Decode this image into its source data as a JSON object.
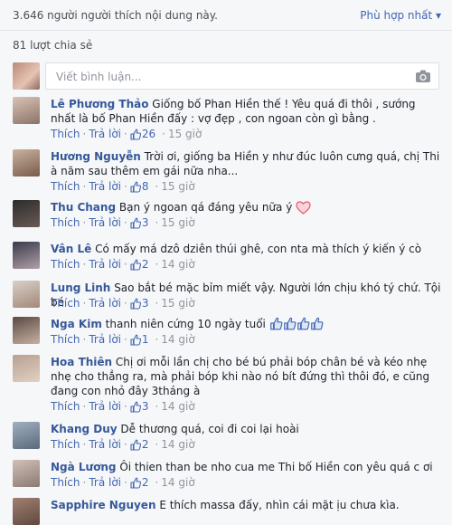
{
  "header": {
    "likes_text": "3.646 người người thích nội dung này.",
    "sort_label": "Phù hợp nhất",
    "shares_text": "81 lượt chia sẻ"
  },
  "composer": {
    "placeholder": "Viết bình luận..."
  },
  "actions": {
    "like": "Thích",
    "reply": "Trả lời"
  },
  "colors": {
    "link": "#4267b2",
    "name": "#365899",
    "muted": "#90949c",
    "background": "#f6f7f9"
  },
  "comments": [
    {
      "name": "Lê Phương Thảo",
      "text": "Giống bố Phan Hiền thế ! Yêu quá đi thôi , sướng nhất là bố Phan Hiền đấy : vợ đẹp , con ngoan còn gì bằng .",
      "like_count": "26",
      "time": "15 giờ"
    },
    {
      "name": "Hương Nguyễn",
      "text": "Trời ơi, giống ba Hiền y như đúc luôn cưng quá, chị Thi à năm sau thêm em gái nữa nha...",
      "like_count": "8",
      "time": "15 giờ"
    },
    {
      "name": "Thu Chang",
      "text": "Bạn ý ngoan qá đáng yêu nữa ý",
      "emoji": "heart-icon",
      "like_count": "3",
      "time": "15 giờ"
    },
    {
      "name": "Vân Lê",
      "text": "Có mấy má dzô dziên thúi ghê, con nta mà thích ý kiến ý cò",
      "like_count": "2",
      "time": "14 giờ"
    },
    {
      "name": "Lung Linh",
      "text": "Sao bắt bé mặc bỉm miết vậy. Người lớn chịu khó tý chứ. Tội bé",
      "like_count": "3",
      "time": "15 giờ"
    },
    {
      "name": "Nga Kim",
      "text": "thanh niên cứng 10 ngày tuổi",
      "emoji": "thumbs-up-icons",
      "like_count": "1",
      "time": "14 giờ"
    },
    {
      "name": "Hoa Thiên",
      "text": "Chị ơi mỗi lần chị cho bé bú phải bóp chân bé và kéo nhẹ nhẹ cho thẳng ra, mà phải bóp khi nào nó bít đứng thì thôi đó, e cũng đang con nhỏ đây 3tháng à",
      "like_count": "3",
      "time": "14 giờ"
    },
    {
      "name": "Khang Duy",
      "text": "Dễ thương quá, coi đi coi lại hoài",
      "like_count": "2",
      "time": "14 giờ"
    },
    {
      "name": "Ngà Lương",
      "text": "Ôi thien than be nho cua me Thi bố Hiền con yêu quá c ơi",
      "like_count": "2",
      "time": "14 giờ"
    },
    {
      "name": "Sapphire Nguyen",
      "text": "E thích massa đấy, nhìn cái mặt ịu chưa kìa."
    }
  ]
}
